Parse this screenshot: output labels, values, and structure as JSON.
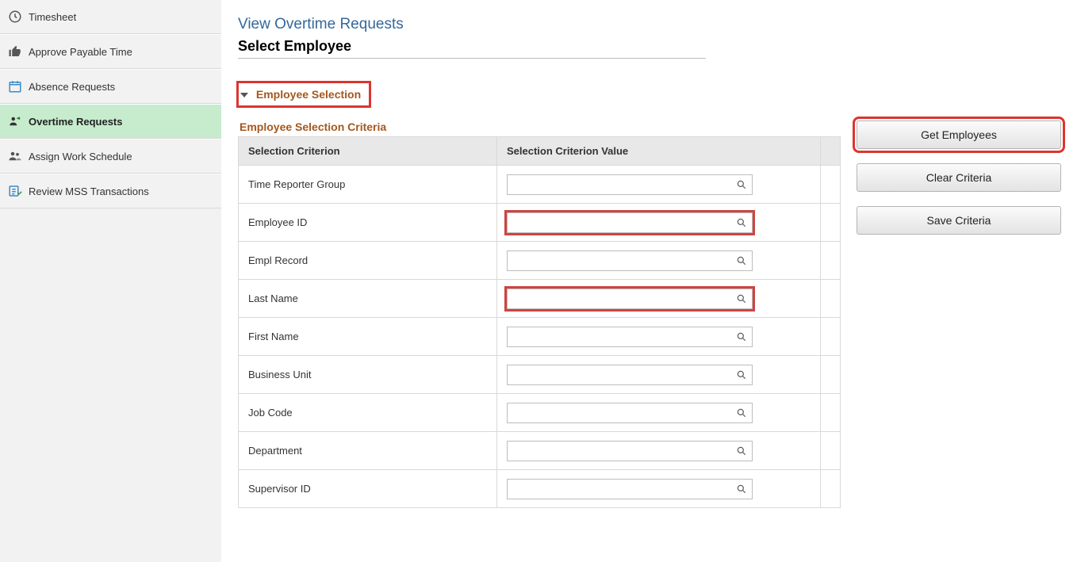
{
  "sidebar": {
    "items": [
      {
        "label": "Timesheet"
      },
      {
        "label": "Approve Payable Time"
      },
      {
        "label": "Absence Requests"
      },
      {
        "label": "Overtime Requests"
      },
      {
        "label": "Assign Work Schedule"
      },
      {
        "label": "Review MSS Transactions"
      }
    ]
  },
  "page": {
    "title": "View Overtime Requests",
    "subtitle": "Select Employee",
    "section_header": "Employee Selection",
    "criteria_heading": "Employee Selection Criteria"
  },
  "table": {
    "header_criterion": "Selection Criterion",
    "header_value": "Selection Criterion Value",
    "rows": [
      {
        "label": "Time Reporter Group",
        "value": "",
        "highlight": false
      },
      {
        "label": "Employee ID",
        "value": "",
        "highlight": true
      },
      {
        "label": "Empl Record",
        "value": "",
        "highlight": false
      },
      {
        "label": "Last Name",
        "value": "",
        "highlight": true
      },
      {
        "label": "First Name",
        "value": "",
        "highlight": false
      },
      {
        "label": "Business Unit",
        "value": "",
        "highlight": false
      },
      {
        "label": "Job Code",
        "value": "",
        "highlight": false
      },
      {
        "label": "Department",
        "value": "",
        "highlight": false
      },
      {
        "label": "Supervisor ID",
        "value": "",
        "highlight": false
      }
    ]
  },
  "actions": {
    "get_employees": "Get Employees",
    "clear_criteria": "Clear Criteria",
    "save_criteria": "Save Criteria"
  }
}
